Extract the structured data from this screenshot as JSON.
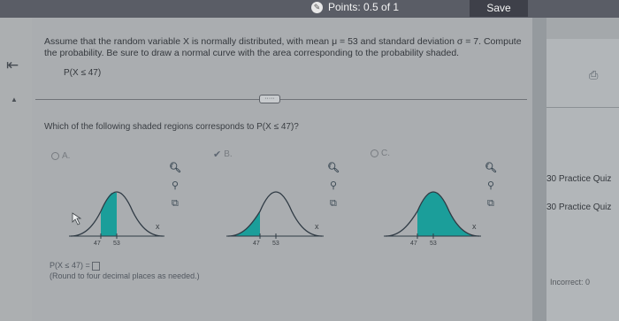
{
  "header": {
    "points_label": "Points: 0.5 of 1",
    "save_label": "Save"
  },
  "nav": {
    "back_glyph": "⇤",
    "collapse_glyph": "▲"
  },
  "question": {
    "text": "Assume that the random variable X is normally distributed, with mean μ = 53 and standard deviation σ = 7. Compute the probability. Be sure to draw a normal curve with the area corresponding to the probability shaded.",
    "expression": "P(X ≤ 47)",
    "more_label": "·····",
    "prompt": "Which of the following shaded regions corresponds to P(X ≤ 47)?"
  },
  "options": [
    {
      "letter": "A.",
      "selected": false,
      "shaded": "center"
    },
    {
      "letter": "B.",
      "selected": true,
      "shaded": "left"
    },
    {
      "letter": "C.",
      "selected": false,
      "shaded": "right"
    }
  ],
  "graph": {
    "tick_left": "47",
    "tick_right": "53",
    "x_label": "x"
  },
  "icons": {
    "zoom_in": "zoom-in-icon",
    "zoom_out": "zoom-out-icon",
    "pop_out": "pop-out-icon",
    "printer": "printer-icon",
    "cursor": "mouse-cursor-icon"
  },
  "answer": {
    "lhs": "P(X ≤ 47) =",
    "hint": "(Round to four decimal places as needed.)"
  },
  "sidebar": {
    "quiz_items": [
      "30 Practice Quiz",
      "30 Practice Quiz"
    ],
    "incorrect_label": "Incorrect: 0"
  },
  "colors": {
    "shade": "#1b9e9a",
    "curve": "#2f3a44",
    "accent_check": "#5d6672"
  }
}
